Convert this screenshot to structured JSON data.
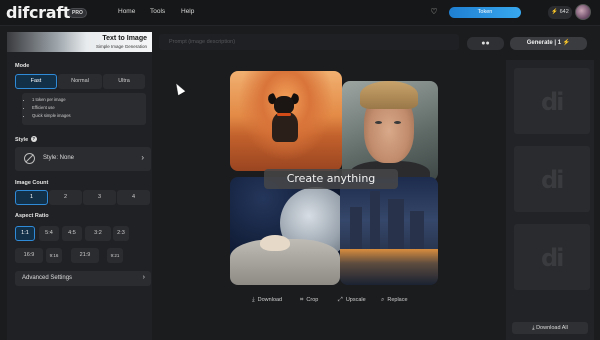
{
  "header": {
    "logo": "difcraft",
    "badge": "PRO",
    "nav": [
      "Home",
      "Tools",
      "Help"
    ],
    "token_button": "Token",
    "credits": "⚡ 642"
  },
  "sidebar": {
    "banner_title": "Text to Image",
    "banner_subtitle": "Simple Image Generation",
    "mode_label": "Mode",
    "modes": [
      "Fast",
      "Normal",
      "Ultra"
    ],
    "mode_selected": "Fast",
    "mode_info": [
      "1 token per image",
      "Efficient use",
      "Quick simple images"
    ],
    "style_label": "Style",
    "style_value": "Style: None",
    "count_label": "Image Count",
    "counts": [
      "1",
      "2",
      "3",
      "4"
    ],
    "count_selected": "1",
    "aspect_label": "Aspect Ratio",
    "aspects_row1": [
      "1:1",
      "5:4",
      "4:5",
      "3:2",
      "2:3"
    ],
    "aspects_row2": [
      "16:9",
      "9:16",
      "21:9",
      "9:21"
    ],
    "aspect_selected": "1:1",
    "advanced": "Advanced Settings"
  },
  "prompt": {
    "placeholder": "Prompt (image description)",
    "generate_label": "Generate | 1 ⚡"
  },
  "canvas": {
    "caption": "Create anything",
    "actions": [
      "Download",
      "Crop",
      "Upscale",
      "Replace"
    ]
  },
  "history": {
    "placeholder_logo": "di",
    "download_all": "Download All"
  },
  "colors": {
    "accent": "#2f8ad8",
    "token_button": "#1f7fd1",
    "background": "#1b1c1e"
  },
  "icons": [
    "heart-icon",
    "lightning-icon",
    "help-icon",
    "no-style-icon",
    "chevron-right-icon",
    "chat-icon",
    "download-icon",
    "crop-icon",
    "upscale-icon",
    "replace-icon",
    "cursor-icon"
  ]
}
